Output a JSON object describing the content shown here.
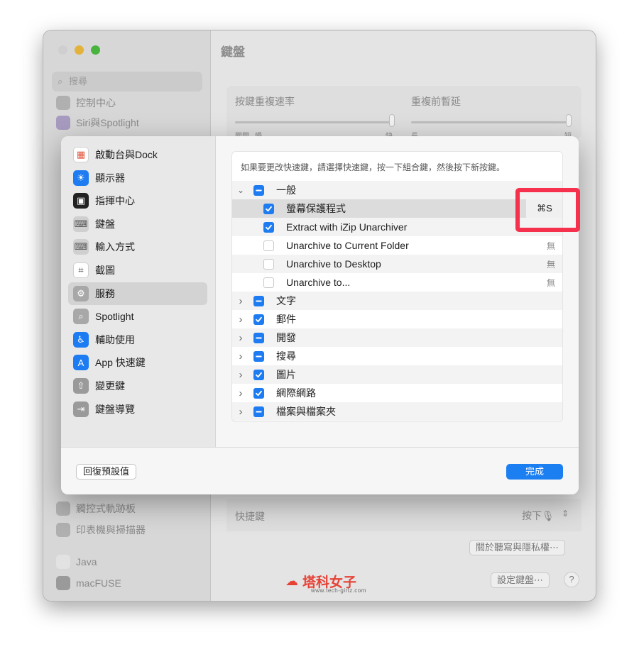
{
  "background_window": {
    "title": "鍵盤",
    "search_placeholder": "搜尋",
    "sidebar_items_top": [
      "控制中心",
      "Siri與Spotlight"
    ],
    "sidebar_items_bottom": [
      "觸控式軌跡板",
      "印表機與掃描器"
    ],
    "sidebar_apps": [
      "Java",
      "macFUSE"
    ],
    "key_repeat_label": "按鍵重複速率",
    "key_repeat_left": "關閉",
    "key_repeat_left2": "慢",
    "key_repeat_right": "快",
    "delay_label": "重複前暫延",
    "delay_left": "長",
    "delay_right": "短",
    "shortcut_label": "快捷鍵",
    "shortcut_value": "按下🎙",
    "about_button": "關於聽寫與隱私權⋯",
    "setup_button": "設定鍵盤⋯",
    "help_button": "?"
  },
  "sheet": {
    "sidebar": [
      {
        "label": "啟動台與Dock",
        "icon": "launchpad-icon",
        "color": "#ffffff"
      },
      {
        "label": "顯示器",
        "icon": "display-icon",
        "color": "#1e7cf2"
      },
      {
        "label": "指揮中心",
        "icon": "mission-control-icon",
        "color": "#222222"
      },
      {
        "label": "鍵盤",
        "icon": "keyboard-icon",
        "color": "#cfcfcf"
      },
      {
        "label": "輸入方式",
        "icon": "input-sources-icon",
        "color": "#cfcfcf"
      },
      {
        "label": "截圖",
        "icon": "screenshot-icon",
        "color": "#ffffff"
      },
      {
        "label": "服務",
        "icon": "services-gear-icon",
        "color": "#a8a8a8"
      },
      {
        "label": "Spotlight",
        "icon": "spotlight-icon",
        "color": "#a8a8a8"
      },
      {
        "label": "輔助使用",
        "icon": "accessibility-icon",
        "color": "#1e7cf2"
      },
      {
        "label": "App 快速鍵",
        "icon": "app-store-icon",
        "color": "#1e7cf2"
      },
      {
        "label": "變更鍵",
        "icon": "modifier-keys-icon",
        "color": "#9a9a9a"
      },
      {
        "label": "鍵盤導覽",
        "icon": "keyboard-navigation-icon",
        "color": "#9a9a9a"
      }
    ],
    "selected_index": 6,
    "hint": "如果要更改快速鍵，請選擇快速鍵，按一下組合鍵，然後按下新按鍵。",
    "rows": [
      {
        "label": "一般",
        "level": 0,
        "chevron": "down",
        "check": "mixed",
        "shortcut": ""
      },
      {
        "label": "螢幕保護程式",
        "level": 1,
        "chevron": "",
        "check": "on",
        "shortcut": "⌘S",
        "selected": true
      },
      {
        "label": "Extract with iZip Unarchiver",
        "level": 1,
        "chevron": "",
        "check": "on",
        "shortcut": ""
      },
      {
        "label": "Unarchive to Current Folder",
        "level": 1,
        "chevron": "",
        "check": "off",
        "shortcut": "無"
      },
      {
        "label": "Unarchive to Desktop",
        "level": 1,
        "chevron": "",
        "check": "off",
        "shortcut": "無"
      },
      {
        "label": "Unarchive to...",
        "level": 1,
        "chevron": "",
        "check": "off",
        "shortcut": "無"
      },
      {
        "label": "文字",
        "level": 0,
        "chevron": "right",
        "check": "mixed",
        "shortcut": ""
      },
      {
        "label": "郵件",
        "level": 0,
        "chevron": "right",
        "check": "on",
        "shortcut": ""
      },
      {
        "label": "開發",
        "level": 0,
        "chevron": "right",
        "check": "mixed",
        "shortcut": ""
      },
      {
        "label": "搜尋",
        "level": 0,
        "chevron": "right",
        "check": "mixed",
        "shortcut": ""
      },
      {
        "label": "圖片",
        "level": 0,
        "chevron": "right",
        "check": "on",
        "shortcut": ""
      },
      {
        "label": "網際網路",
        "level": 0,
        "chevron": "right",
        "check": "on",
        "shortcut": ""
      },
      {
        "label": "檔案與檔案夾",
        "level": 0,
        "chevron": "right",
        "check": "mixed",
        "shortcut": ""
      }
    ],
    "reset_button": "回復預設值",
    "done_button": "完成"
  },
  "watermark": {
    "text": "塔科女子",
    "url": "www.tech-girlz.com"
  },
  "colors": {
    "accent": "#1e7cf2",
    "highlight": "#f5314d"
  }
}
